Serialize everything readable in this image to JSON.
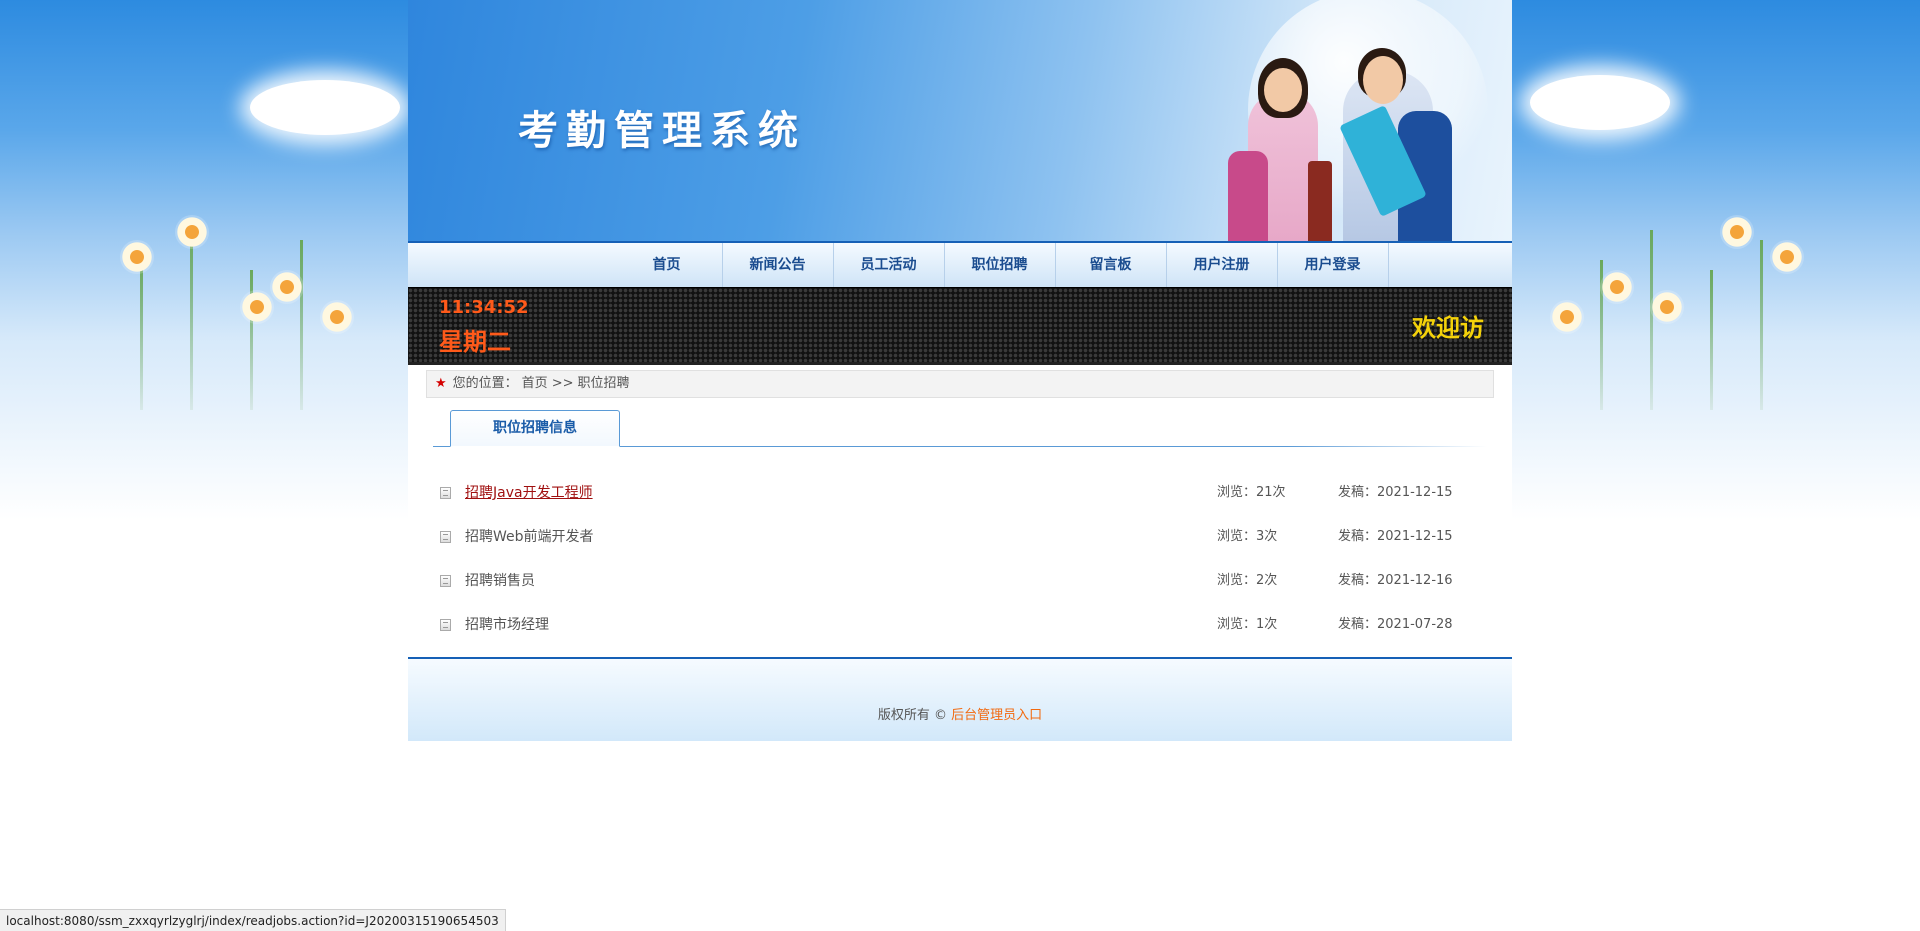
{
  "site": {
    "title": "考勤管理系统"
  },
  "nav": {
    "items": [
      {
        "label": "首页"
      },
      {
        "label": "新闻公告"
      },
      {
        "label": "员工活动"
      },
      {
        "label": "职位招聘"
      },
      {
        "label": "留言板"
      },
      {
        "label": "用户注册"
      },
      {
        "label": "用户登录"
      }
    ]
  },
  "ledbar": {
    "time": "11:34:52",
    "weekday": "星期二",
    "marquee": "欢迎访"
  },
  "breadcrumb": {
    "prefix": "您的位置：",
    "home": "首页",
    "separator": ">>",
    "current": "职位招聘"
  },
  "tab": {
    "label": "职位招聘信息"
  },
  "jobs": [
    {
      "title": "招聘Java开发工程师",
      "views": "浏览：21次",
      "date": "发稿：2021-12-15"
    },
    {
      "title": "招聘Web前端开发者",
      "views": "浏览：3次",
      "date": "发稿：2021-12-15"
    },
    {
      "title": "招聘销售员",
      "views": "浏览：2次",
      "date": "发稿：2021-12-16"
    },
    {
      "title": "招聘市场经理",
      "views": "浏览：1次",
      "date": "发稿：2021-07-28"
    }
  ],
  "footer": {
    "copyright": "版权所有 © ",
    "admin_link": "后台管理员入口"
  },
  "statusbar": {
    "url": "localhost:8080/ssm_zxxqyrlzyglrj/index/readjobs.action?id=J20200315190654503"
  },
  "colors": {
    "primary_blue": "#1560b6",
    "led_orange": "#ff5a1a",
    "led_yellow": "#f4d20a",
    "active_link": "#a01010",
    "footer_link": "#f26a10"
  }
}
